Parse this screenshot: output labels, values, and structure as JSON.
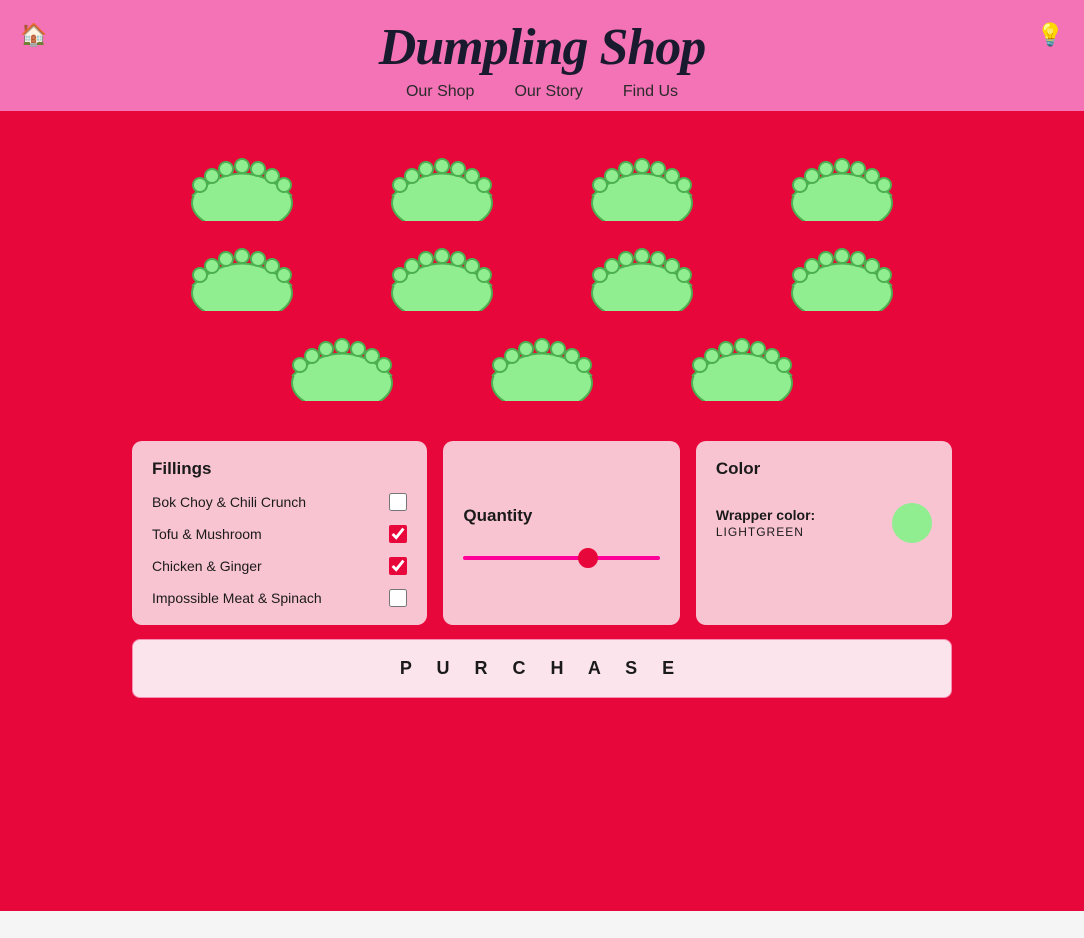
{
  "header": {
    "title": "Dumpling Shop",
    "home_icon": "🏠",
    "settings_icon": "💡",
    "nav": {
      "items": [
        {
          "label": "Our Shop",
          "id": "our-shop"
        },
        {
          "label": "Our Story",
          "id": "our-story"
        },
        {
          "label": "Find Us",
          "id": "find-us"
        }
      ]
    }
  },
  "dumplings": {
    "rows": [
      {
        "count": 4
      },
      {
        "count": 4
      },
      {
        "count": 3
      }
    ],
    "fill_color": "#90EE90",
    "stroke_color": "#4CAF50"
  },
  "fillings": {
    "title": "Fillings",
    "items": [
      {
        "label": "Bok Choy & Chili Crunch",
        "checked": false
      },
      {
        "label": "Tofu & Mushroom",
        "checked": true
      },
      {
        "label": "Chicken & Ginger",
        "checked": true
      },
      {
        "label": "Impossible Meat & Spinach",
        "checked": false
      }
    ]
  },
  "quantity": {
    "title": "Quantity",
    "value": 65,
    "min": 0,
    "max": 100
  },
  "color": {
    "title": "Color",
    "wrapper_label": "Wrapper color:",
    "wrapper_value": "LIGHTGREEN",
    "swatch": "lightgreen"
  },
  "purchase": {
    "label": "P U R C H A S E"
  }
}
